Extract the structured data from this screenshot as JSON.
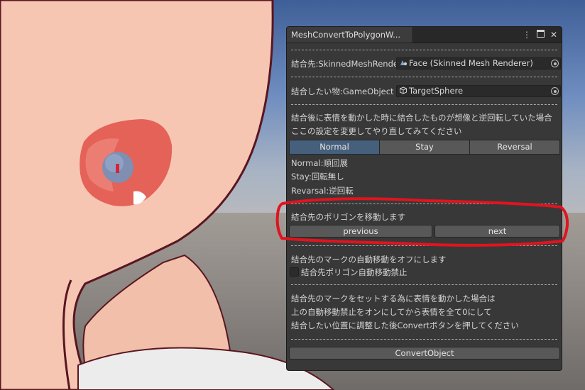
{
  "window": {
    "tab_title": "MeshConvertToPolygonW...",
    "icons": [
      "more-options-icon",
      "maximize-icon",
      "close-icon"
    ]
  },
  "fields": {
    "target_label": "結合先:SkinnedMeshRende",
    "target_value": "Face (Skinned Mesh Renderer)",
    "source_label": "結合したい物:GameObject",
    "source_value": "TargetSphere"
  },
  "rotation": {
    "hint_line1": "結合後に表情を動かした時に結合したものが想像と逆回転していた場合",
    "hint_line2": "ここの設定を変更してやり直してみてください",
    "options": [
      "Normal",
      "Stay",
      "Reversal"
    ],
    "selected": "Normal",
    "desc_normal": "Normal:順回展",
    "desc_stay": "Stay:回転無し",
    "desc_reversal": "Revarsal:逆回転"
  },
  "polygon_move": {
    "label": "結合先のポリゴンを移動します",
    "previous_label": "previous",
    "next_label": "next"
  },
  "auto_move": {
    "label": "結合先のマークの自動移動をオフにします",
    "checkbox_label": "結合先ポリゴン自動移動禁止",
    "checked": false
  },
  "instructions": {
    "line1": "結合先のマークをセットする為に表情を動かした場合は",
    "line2": "上の自動移動禁止をオンにしてから表情を全て0にして",
    "line3": "結合したい位置に調整した後Convertボタンを押してください"
  },
  "convert_label": "ConvertObject",
  "colors": {
    "annotation": "#e0141e",
    "selected_toggle": "#46607c",
    "panel_bg": "#383838"
  }
}
